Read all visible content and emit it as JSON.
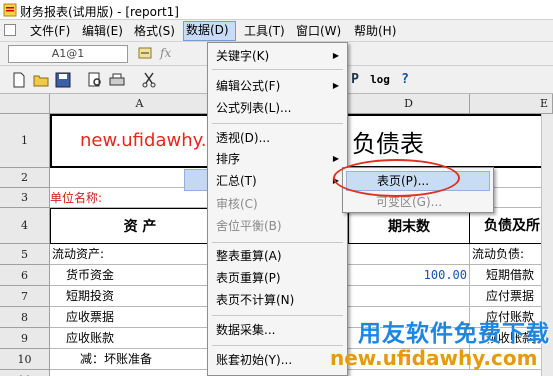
{
  "window": {
    "title": "财务报表(试用版) - [report1]"
  },
  "menubar": [
    {
      "label": "文件(F)"
    },
    {
      "label": "编辑(E)"
    },
    {
      "label": "格式(S)"
    },
    {
      "label": "数据(D)"
    },
    {
      "label": "工具(T)"
    },
    {
      "label": "窗口(W)"
    },
    {
      "label": "帮助(H)"
    }
  ],
  "editbar": {
    "cell_ref": "A1@1",
    "fx": "fx"
  },
  "toolbar": {
    "icons": [
      "new-icon",
      "open-icon",
      "save-icon",
      "preview-icon",
      "print-icon",
      "cut-icon",
      "p-icon",
      "log-icon",
      "help-icon"
    ],
    "p_label": "P",
    "log_label": "log",
    "help_label": "?"
  },
  "sheet": {
    "col_headers": {
      "A": "A",
      "D": "D",
      "E": "E"
    },
    "row_headers": [
      "1",
      "2",
      "3",
      "4",
      "5",
      "6",
      "7",
      "8",
      "9",
      "10",
      "11"
    ],
    "title_fragment": "负债表",
    "unit_label": "单位名称:",
    "row4": {
      "asset": "资      产",
      "end": "期末数",
      "liab": "负债及所"
    },
    "row5": {
      "asset": "流动资产:",
      "liab": "流动负债:"
    },
    "rows": [
      {
        "asset": "货币资金",
        "end": "100.00",
        "liab": "短期借款"
      },
      {
        "asset": "短期投资",
        "end": "",
        "liab": "应付票据"
      },
      {
        "asset": "应收票据",
        "end": "",
        "liab": "应付账款"
      },
      {
        "asset": "应收账款",
        "end": "",
        "liab": "预收账款"
      },
      {
        "asset": "减：坏账准备",
        "end": "",
        "liab": ""
      }
    ]
  },
  "data_menu": {
    "items": [
      {
        "label": "关键字(K)",
        "submenu": true,
        "disabled": false
      },
      {
        "label": "编辑公式(F)",
        "submenu": true,
        "disabled": false
      },
      {
        "label": "公式列表(L)...",
        "submenu": false,
        "disabled": false
      },
      {
        "label": "透视(D)...",
        "submenu": false,
        "disabled": false
      },
      {
        "label": "排序",
        "submenu": true,
        "disabled": false
      },
      {
        "label": "汇总(T)",
        "submenu": true,
        "disabled": false
      },
      {
        "label": "审核(C)",
        "submenu": false,
        "disabled": true
      },
      {
        "label": "舍位平衡(B)",
        "submenu": false,
        "disabled": true
      },
      {
        "label": "整表重算(A)",
        "submenu": false,
        "disabled": false
      },
      {
        "label": "表页重算(P)",
        "submenu": false,
        "disabled": false
      },
      {
        "label": "表页不计算(N)",
        "submenu": false,
        "disabled": false
      },
      {
        "label": "数据采集...",
        "submenu": false,
        "disabled": false
      },
      {
        "label": "账套初始(Y)...",
        "submenu": false,
        "disabled": false
      }
    ],
    "arrow": "▶"
  },
  "submenu": {
    "item1": "表页(P)...",
    "item2": "可变区(G)..."
  },
  "watermarks": {
    "url": "new.ufidawhy.com",
    "cn": "用友软件免费下载",
    "url2": "new.ufidawhy.com"
  },
  "colors": {
    "accent_red": "#e03020",
    "watermark_blue": "#1e86e0",
    "menu_highlight": "#c5d8f3"
  }
}
